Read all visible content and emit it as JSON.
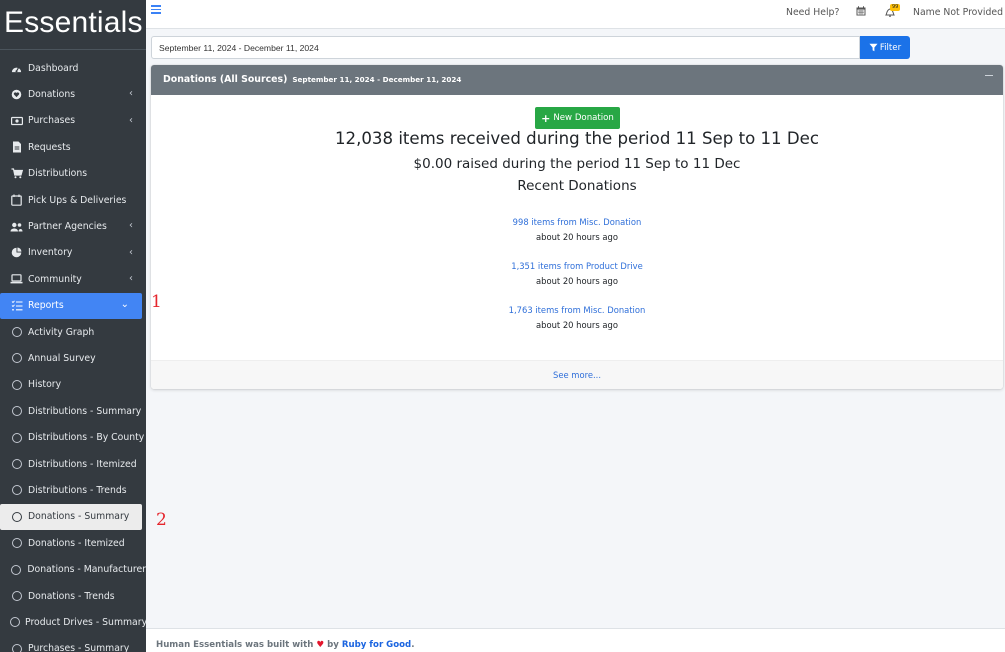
{
  "brand": "Essentials",
  "topbar": {
    "help_label": "Need Help?",
    "notification_badge": "99",
    "user_name": "Name Not Provided"
  },
  "sidebar": {
    "items": [
      {
        "label": "Dashboard",
        "icon": "dashboard-icon",
        "caret": false
      },
      {
        "label": "Donations",
        "icon": "donations-icon",
        "caret": true
      },
      {
        "label": "Purchases",
        "icon": "purchases-icon",
        "caret": true
      },
      {
        "label": "Requests",
        "icon": "requests-icon",
        "caret": false
      },
      {
        "label": "Distributions",
        "icon": "distributions-icon",
        "caret": false
      },
      {
        "label": "Pick Ups & Deliveries",
        "icon": "calendar-icon",
        "caret": false
      },
      {
        "label": "Partner Agencies",
        "icon": "users-icon",
        "caret": true
      },
      {
        "label": "Inventory",
        "icon": "inventory-icon",
        "caret": true
      },
      {
        "label": "Community",
        "icon": "laptop-icon",
        "caret": true
      },
      {
        "label": "Reports",
        "icon": "reports-icon",
        "caret": true,
        "active": true
      },
      {
        "label": "Activity Graph",
        "icon": "circle-icon"
      },
      {
        "label": "Annual Survey",
        "icon": "circle-icon"
      },
      {
        "label": "History",
        "icon": "circle-icon"
      },
      {
        "label": "Distributions - Summary",
        "icon": "circle-icon"
      },
      {
        "label": "Distributions - By County",
        "icon": "circle-icon"
      },
      {
        "label": "Distributions - Itemized",
        "icon": "circle-icon"
      },
      {
        "label": "Distributions - Trends",
        "icon": "circle-icon"
      },
      {
        "label": "Donations - Summary",
        "icon": "circle-icon",
        "selected": true
      },
      {
        "label": "Donations - Itemized",
        "icon": "circle-icon"
      },
      {
        "label": "Donations - Manufacturer",
        "icon": "circle-icon"
      },
      {
        "label": "Donations - Trends",
        "icon": "circle-icon"
      },
      {
        "label": "Product Drives - Summary",
        "icon": "circle-icon"
      },
      {
        "label": "Purchases - Summary",
        "icon": "circle-icon"
      }
    ]
  },
  "filter": {
    "date_range": "September 11, 2024 - December 11, 2024",
    "button_label": "Filter"
  },
  "card": {
    "title": "Donations (All Sources)",
    "subtitle": "September 11, 2024 - December 11, 2024",
    "new_button": "New Donation",
    "items_text": "12,038 items received during the period 11 Sep to 11 Dec",
    "money_text": "$0.00 raised during the period 11 Sep to 11 Dec",
    "recent_title": "Recent Donations",
    "donations": [
      {
        "link": "998 items from Misc. Donation",
        "time": "about 20 hours ago"
      },
      {
        "link": "1,351 items from Product Drive",
        "time": "about 20 hours ago"
      },
      {
        "link": "1,763 items from Misc. Donation",
        "time": "about 20 hours ago"
      }
    ],
    "see_more": "See more..."
  },
  "footer": {
    "prefix": "Human Essentials was built with",
    "by": "by",
    "link": "Ruby for Good",
    "suffix": "."
  },
  "annotations": {
    "one": "1",
    "two": "2"
  },
  "colors": {
    "sidebar_bg": "#343a40",
    "active_blue": "#4285f4",
    "success_green": "#28a745",
    "card_header": "#6c757d",
    "link_blue": "#2f6fd9",
    "annotation_red": "#e5262d"
  }
}
